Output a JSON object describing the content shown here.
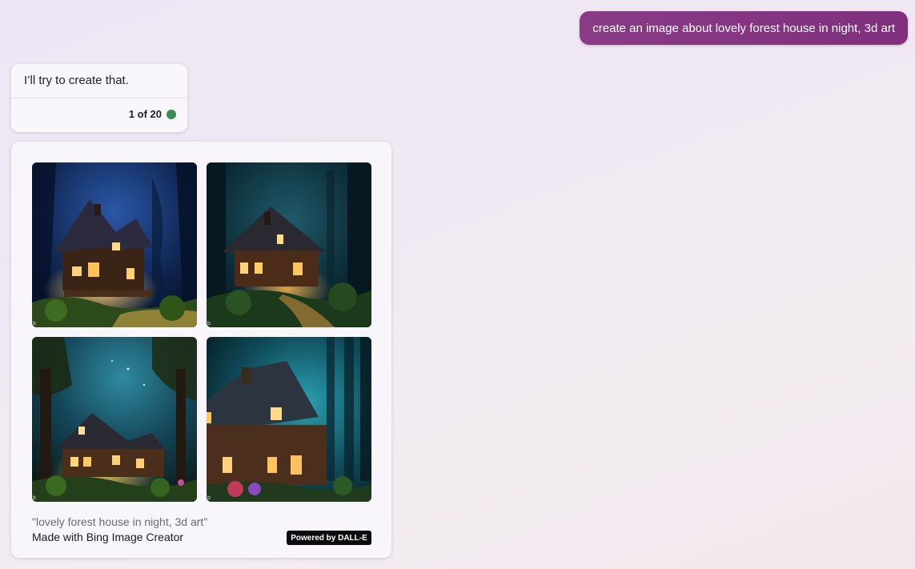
{
  "conversation": {
    "user_message": "create an image about lovely forest house in night, 3d art",
    "bot_message": {
      "text": "I’ll try to create that.",
      "turn_counter": "1 of 20",
      "status_color": "#3d8c4f"
    },
    "image_card": {
      "images": [
        {
          "icon": "forest-house-image-1"
        },
        {
          "icon": "forest-house-image-2"
        },
        {
          "icon": "forest-house-image-3"
        },
        {
          "icon": "forest-house-image-4"
        }
      ],
      "prompt_caption": "\"lovely forest house in night, 3d art\"",
      "attribution": "Made with Bing Image Creator",
      "badge": "Powered by DALL-E"
    }
  },
  "colors": {
    "user_bubble": "#8a3b86",
    "badge_bg": "#0b0b0b"
  }
}
